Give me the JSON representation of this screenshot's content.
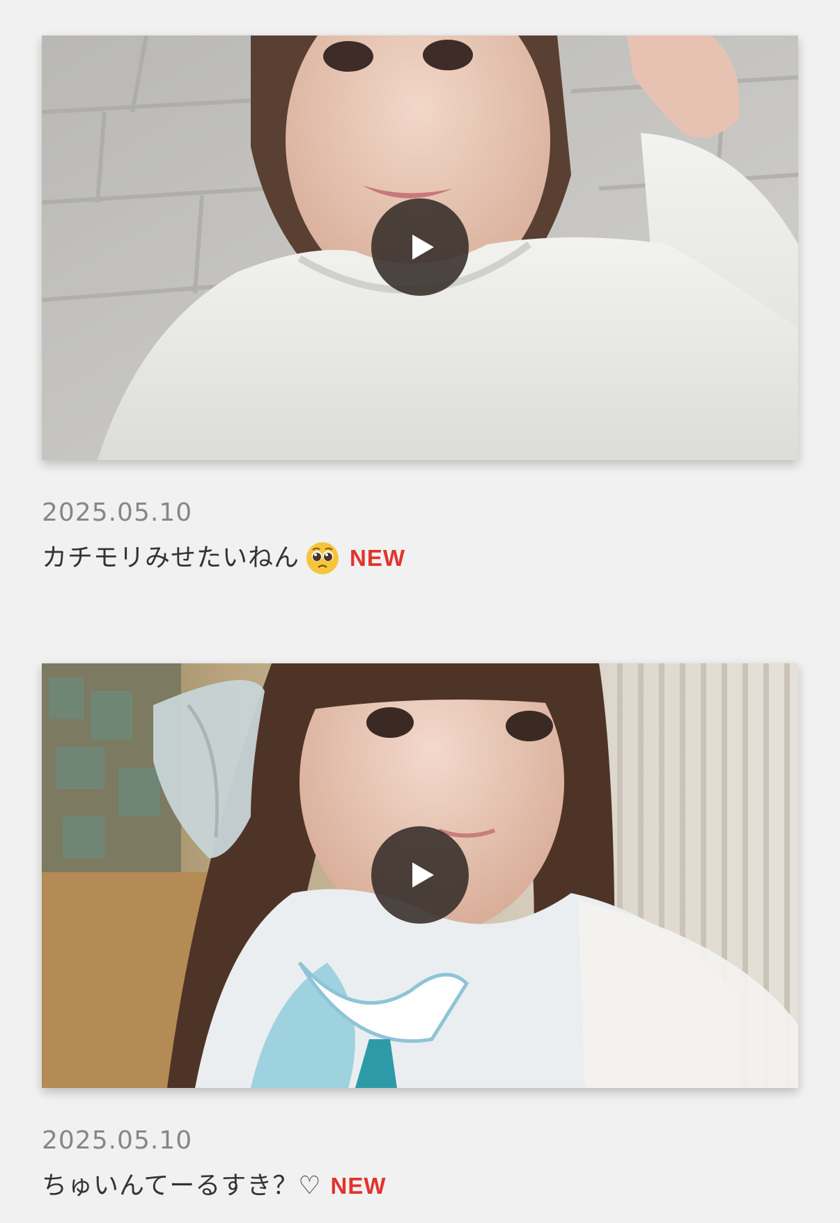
{
  "posts": [
    {
      "date": "2025.05.10",
      "title": "カチモリみせたいねん",
      "emoji": "pleading-face",
      "badge": "NEW",
      "thumbnail": "video-thumbnail-white-tshirt-selfie",
      "play_icon": "play-icon"
    },
    {
      "date": "2025.05.10",
      "title": "ちゅいんてーるすき？",
      "title_suffix": "♡",
      "badge": "NEW",
      "thumbnail": "video-thumbnail-blue-ribbon-selfie",
      "play_icon": "play-icon"
    }
  ],
  "colors": {
    "background": "#f1f1f1",
    "date_text": "#8a8583",
    "title_text": "#333333",
    "new_badge": "#e0342c",
    "play_button": "#342c28"
  }
}
